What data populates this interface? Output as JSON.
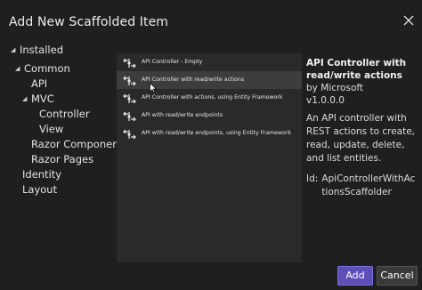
{
  "window": {
    "title": "Add New Scaffolded Item"
  },
  "tree": {
    "installed": "Installed",
    "common": "Common",
    "api": "API",
    "mvc": "MVC",
    "controller": "Controller",
    "view": "View",
    "razor_component": "Razor Component",
    "razor_pages": "Razor Pages",
    "identity": "Identity",
    "layout": "Layout"
  },
  "templates": [
    {
      "label": "API Controller - Empty",
      "icon": "api-controller-icon"
    },
    {
      "label": "API Controller with read/write actions",
      "icon": "api-controller-icon",
      "selected": true
    },
    {
      "label": "API Controller with actions, using Entity Framework",
      "icon": "api-controller-icon"
    },
    {
      "label": "API with read/write endpoints",
      "icon": "api-controller-icon"
    },
    {
      "label": "API with read/write endpoints, using Entity Framework",
      "icon": "api-controller-icon"
    }
  ],
  "detail": {
    "title_line1": "API Controller with",
    "title_line2": "read/write actions",
    "by": "by Microsoft",
    "version": "v1.0.0.0",
    "description": "An API controller with REST actions to create, read, update, delete, and list entities.",
    "id_label": "Id:",
    "id_value": "ApiControllerWithActionsScaffolder"
  },
  "buttons": {
    "add": "Add",
    "cancel": "Cancel"
  },
  "colors": {
    "accent": "#5c50b8",
    "selected_row": "#3d3d3d",
    "background": "#1f1f1f",
    "list_bg": "#2a2a2a"
  }
}
